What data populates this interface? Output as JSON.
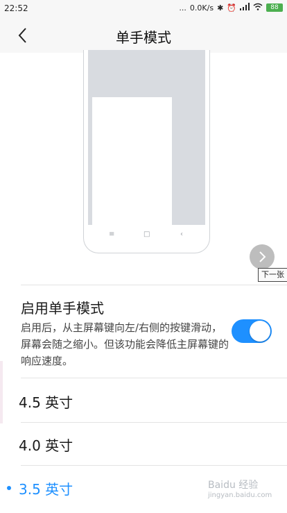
{
  "status_bar": {
    "time": "22:52",
    "dots": "...",
    "net_speed": "0.0K/s",
    "battery": "88"
  },
  "header": {
    "title": "单手模式"
  },
  "preview": {
    "next_tooltip": "下一张"
  },
  "enable": {
    "title": "启用单手模式",
    "description": "启用后，从主屏幕键向左/右侧的按键滑动，屏幕会随之缩小。但该功能会降低主屏幕键的响应速度。",
    "toggle_on": true
  },
  "sizes": [
    {
      "label": "4.5 英寸",
      "selected": false
    },
    {
      "label": "4.0 英寸",
      "selected": false
    },
    {
      "label": "3.5 英寸",
      "selected": true
    }
  ],
  "watermark": {
    "text": "Baidu 经验",
    "url": "jingyan.baidu.com"
  },
  "colors": {
    "accent": "#1e90ff",
    "header_bg": "#f7f7f7"
  }
}
